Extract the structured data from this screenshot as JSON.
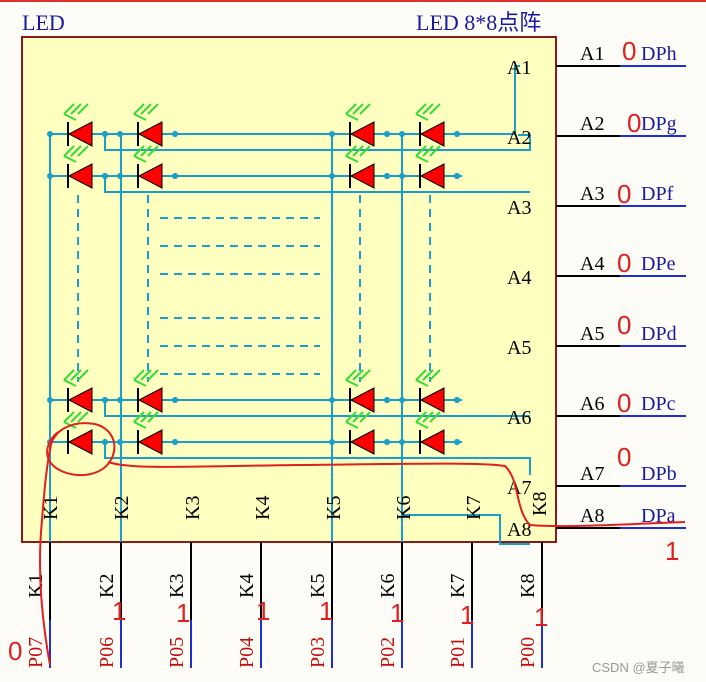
{
  "component": {
    "name": "LED",
    "title": "LED 8*8点阵"
  },
  "row_pins": [
    "A1",
    "A2",
    "A3",
    "A4",
    "A5",
    "A6",
    "A7",
    "A8"
  ],
  "col_pins_internal": [
    "K1",
    "K2",
    "K3",
    "K4",
    "K5",
    "K6",
    "K7",
    "K8"
  ],
  "col_pins_external": [
    "K1",
    "K2",
    "K3",
    "K4",
    "K5",
    "K6",
    "K7",
    "K8"
  ],
  "ports": [
    "P07",
    "P06",
    "P05",
    "P04",
    "P03",
    "P02",
    "P01",
    "P00"
  ],
  "row_nets": [
    "DPh",
    "DPg",
    "DPf",
    "DPe",
    "DPd",
    "DPc",
    "DPb",
    "DPa"
  ],
  "row_values": [
    "0",
    "0",
    "0",
    "0",
    "0",
    "0",
    "0",
    "1"
  ],
  "port_values": [
    "0",
    "1",
    "1",
    "1",
    "1",
    "1",
    "1",
    "1"
  ],
  "watermark": "CSDN @夏子曦",
  "colors": {
    "body_fill": "#ffffc0",
    "body_stroke": "#8b1a1a",
    "wire": "#1aa0c8",
    "led_red": "#ff0000",
    "led_green": "#33dd33",
    "label_blue": "#1a1aa0",
    "annotation_red": "#e02020",
    "net_underline": "#2030d0"
  }
}
